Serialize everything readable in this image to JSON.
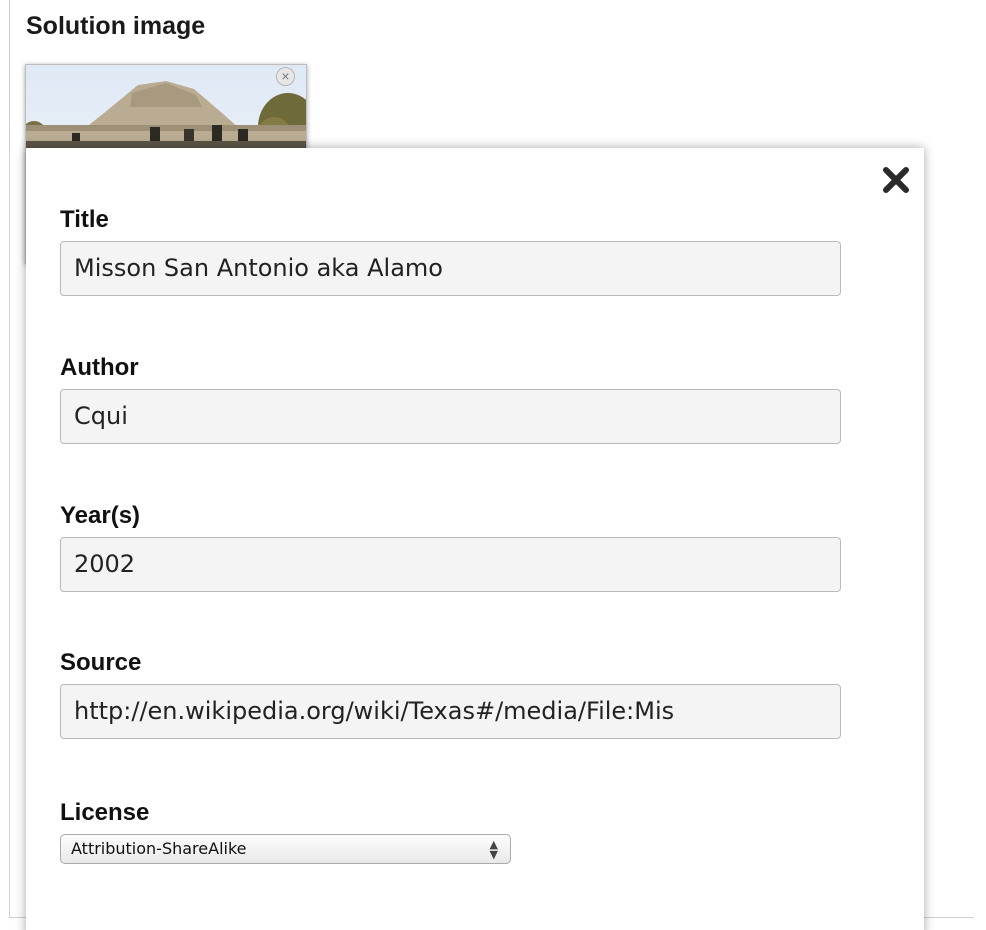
{
  "section_title": "Solution image",
  "dialog": {
    "fields": {
      "title": {
        "label": "Title",
        "value": "Misson San Antonio aka Alamo"
      },
      "author": {
        "label": "Author",
        "value": "Cqui"
      },
      "year": {
        "label": "Year(s)",
        "value": "2002"
      },
      "source": {
        "label": "Source",
        "value": "http://en.wikipedia.org/wiki/Texas#/media/File:Mis"
      }
    },
    "license": {
      "label": "License",
      "selected": "Attribution-ShareAlike"
    }
  },
  "icons": {
    "thumbnail_remove": "close-circle-icon",
    "dialog_close": "close-icon",
    "select_arrows": "updown-arrows-icon"
  }
}
